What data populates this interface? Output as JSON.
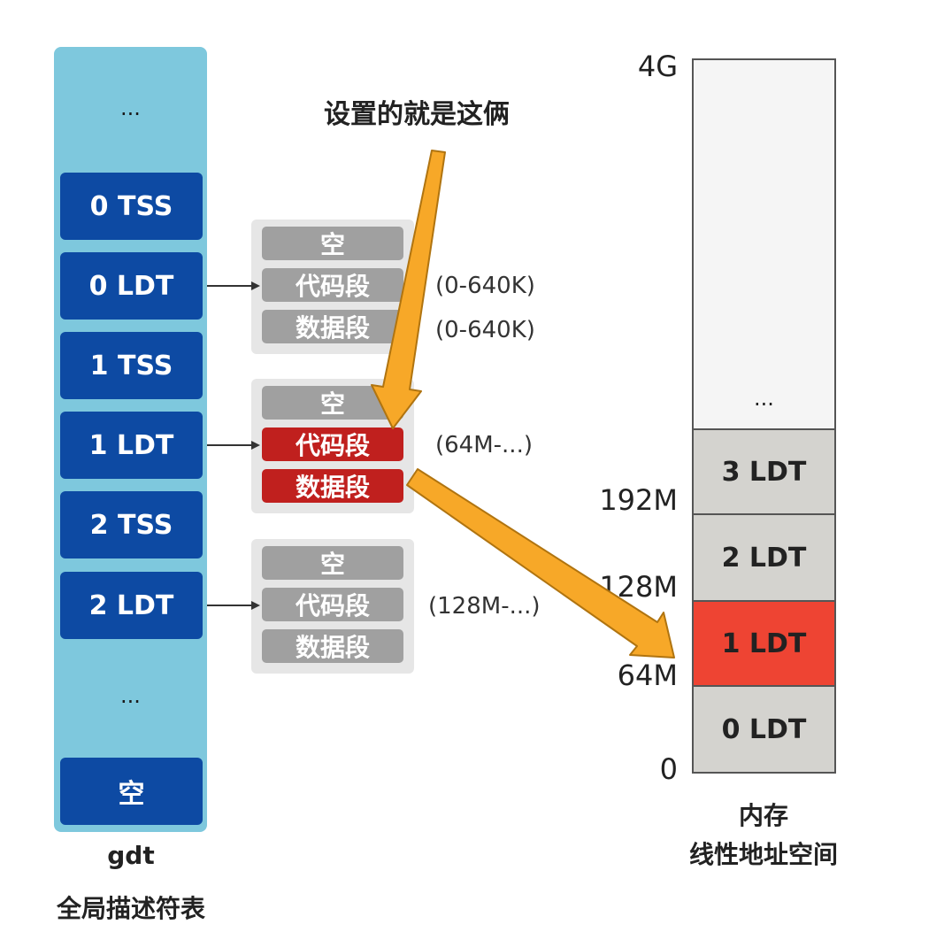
{
  "gdt": {
    "top_dots": "...",
    "entries": [
      "0 TSS",
      "0 LDT",
      "1 TSS",
      "1 LDT",
      "2 TSS",
      "2 LDT"
    ],
    "bottom_dots": "...",
    "empty_entry": "空",
    "label_en": "gdt",
    "label_zh": "全局描述符表"
  },
  "annotation": "设置的就是这俩",
  "ldt_tables": [
    {
      "segments": [
        "空",
        "代码段",
        "数据段"
      ],
      "code_range": "(0-640K)",
      "data_range": "(0-640K)",
      "highlighted": false
    },
    {
      "segments": [
        "空",
        "代码段",
        "数据段"
      ],
      "code_range": "(64M-...)",
      "highlighted": true
    },
    {
      "segments": [
        "空",
        "代码段",
        "数据段"
      ],
      "code_range": "(128M-...)",
      "highlighted": false
    }
  ],
  "memory": {
    "top_dots": "...",
    "blocks": [
      "3 LDT",
      "2 LDT",
      "1 LDT",
      "0 LDT"
    ],
    "highlighted_block": "1 LDT",
    "ticks": [
      "4G",
      "192M",
      "128M",
      "64M",
      "0"
    ],
    "caption_line1": "内存",
    "caption_line2": "线性地址空间"
  },
  "colors": {
    "gdt_background": "#7ec8dd",
    "gdt_entry": "#0d4aa3",
    "segment_gray": "#a0a0a0",
    "segment_red": "#c0201e",
    "memory_block": "#d4d3cf",
    "memory_highlight": "#ee4433",
    "arrow_orange": "#f7a828"
  }
}
